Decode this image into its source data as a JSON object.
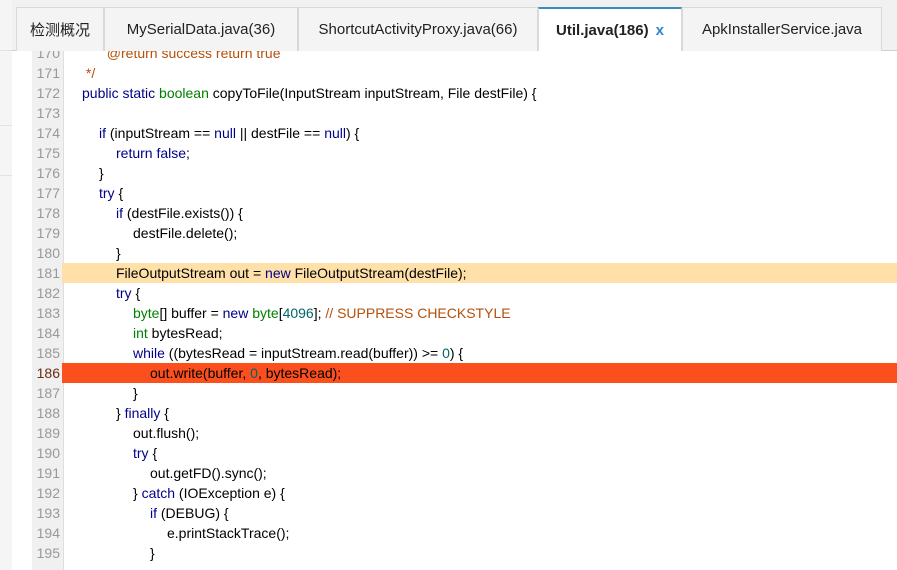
{
  "tabs": [
    {
      "label": "检测概况",
      "active": false
    },
    {
      "label": "MySerialData.java(36)",
      "active": false
    },
    {
      "label": "ShortcutActivityProxy.java(66)",
      "active": false
    },
    {
      "label": "Util.java(186)",
      "active": true,
      "close": "x"
    },
    {
      "label": "ApkInstallerService.java",
      "active": false
    }
  ],
  "colors": {
    "caret_line": "#ffe0a8",
    "error_line": "#fc4f1e",
    "keyword": "#000088",
    "type": "#008000",
    "number": "#006666",
    "comment": "#b5500a"
  },
  "highlights": {
    "soft_line": 181,
    "strong_line": 186
  },
  "code": [
    {
      "n": "170",
      "indent": 1,
      "tokens": [
        {
          "t": "  @return success return true",
          "c": "cm"
        }
      ]
    },
    {
      "n": "171",
      "indent": 0,
      "tokens": [
        {
          "t": " */",
          "c": "cm"
        }
      ]
    },
    {
      "n": "172",
      "indent": 0,
      "tokens": [
        {
          "t": "public static ",
          "c": "kw"
        },
        {
          "t": "boolean",
          "c": "ty"
        },
        {
          "t": " copyToFile(InputStream inputStream, File destFile) {",
          "c": ""
        }
      ]
    },
    {
      "n": "173",
      "indent": 0,
      "tokens": []
    },
    {
      "n": "174",
      "indent": 1,
      "tokens": [
        {
          "t": "if",
          "c": "kw"
        },
        {
          "t": " (inputStream == ",
          "c": ""
        },
        {
          "t": "null",
          "c": "kw"
        },
        {
          "t": " || destFile == ",
          "c": ""
        },
        {
          "t": "null",
          "c": "kw"
        },
        {
          "t": ") {",
          "c": ""
        }
      ]
    },
    {
      "n": "175",
      "indent": 2,
      "tokens": [
        {
          "t": "return false",
          "c": "kw"
        },
        {
          "t": ";",
          "c": ""
        }
      ]
    },
    {
      "n": "176",
      "indent": 1,
      "tokens": [
        {
          "t": "}",
          "c": ""
        }
      ]
    },
    {
      "n": "177",
      "indent": 1,
      "tokens": [
        {
          "t": "try",
          "c": "kw"
        },
        {
          "t": " {",
          "c": ""
        }
      ]
    },
    {
      "n": "178",
      "indent": 2,
      "tokens": [
        {
          "t": "if",
          "c": "kw"
        },
        {
          "t": " (destFile.exists()) {",
          "c": ""
        }
      ]
    },
    {
      "n": "179",
      "indent": 3,
      "tokens": [
        {
          "t": "destFile.delete();",
          "c": ""
        }
      ]
    },
    {
      "n": "180",
      "indent": 2,
      "tokens": [
        {
          "t": "}",
          "c": ""
        }
      ]
    },
    {
      "n": "181",
      "indent": 2,
      "tokens": [
        {
          "t": "FileOutputStream out = ",
          "c": ""
        },
        {
          "t": "new",
          "c": "kw"
        },
        {
          "t": " FileOutputStream(destFile);",
          "c": ""
        }
      ]
    },
    {
      "n": "182",
      "indent": 2,
      "tokens": [
        {
          "t": "try",
          "c": "kw"
        },
        {
          "t": " {",
          "c": ""
        }
      ]
    },
    {
      "n": "183",
      "indent": 3,
      "tokens": [
        {
          "t": "byte",
          "c": "ty"
        },
        {
          "t": "[] buffer = ",
          "c": ""
        },
        {
          "t": "new",
          "c": "kw"
        },
        {
          "t": " ",
          "c": ""
        },
        {
          "t": "byte",
          "c": "ty"
        },
        {
          "t": "[",
          "c": ""
        },
        {
          "t": "4096",
          "c": "nu"
        },
        {
          "t": "]; ",
          "c": ""
        },
        {
          "t": "// SUPPRESS CHECKSTYLE",
          "c": "cm"
        }
      ]
    },
    {
      "n": "184",
      "indent": 3,
      "tokens": [
        {
          "t": "int",
          "c": "ty"
        },
        {
          "t": " bytesRead;",
          "c": ""
        }
      ]
    },
    {
      "n": "185",
      "indent": 3,
      "tokens": [
        {
          "t": "while",
          "c": "kw"
        },
        {
          "t": " ((bytesRead = inputStream.read(buffer)) >= ",
          "c": ""
        },
        {
          "t": "0",
          "c": "nu"
        },
        {
          "t": ") {",
          "c": ""
        }
      ]
    },
    {
      "n": "186",
      "indent": 4,
      "tokens": [
        {
          "t": "out.write(buffer, ",
          "c": ""
        },
        {
          "t": "0",
          "c": "nu"
        },
        {
          "t": ", bytesRead);",
          "c": ""
        }
      ]
    },
    {
      "n": "187",
      "indent": 3,
      "tokens": [
        {
          "t": "}",
          "c": ""
        }
      ]
    },
    {
      "n": "188",
      "indent": 2,
      "tokens": [
        {
          "t": "} ",
          "c": ""
        },
        {
          "t": "finally",
          "c": "kw"
        },
        {
          "t": " {",
          "c": ""
        }
      ]
    },
    {
      "n": "189",
      "indent": 3,
      "tokens": [
        {
          "t": "out.flush();",
          "c": ""
        }
      ]
    },
    {
      "n": "190",
      "indent": 3,
      "tokens": [
        {
          "t": "try",
          "c": "kw"
        },
        {
          "t": " {",
          "c": ""
        }
      ]
    },
    {
      "n": "191",
      "indent": 4,
      "tokens": [
        {
          "t": "out.getFD().sync();",
          "c": ""
        }
      ]
    },
    {
      "n": "192",
      "indent": 3,
      "tokens": [
        {
          "t": "} ",
          "c": ""
        },
        {
          "t": "catch",
          "c": "kw"
        },
        {
          "t": " (IOException e) {",
          "c": ""
        }
      ]
    },
    {
      "n": "193",
      "indent": 4,
      "tokens": [
        {
          "t": "if",
          "c": "kw"
        },
        {
          "t": " (DEBUG) {",
          "c": ""
        }
      ]
    },
    {
      "n": "194",
      "indent": 5,
      "tokens": [
        {
          "t": "e.printStackTrace();",
          "c": ""
        }
      ]
    },
    {
      "n": "195",
      "indent": 4,
      "tokens": [
        {
          "t": "}",
          "c": ""
        }
      ]
    }
  ]
}
